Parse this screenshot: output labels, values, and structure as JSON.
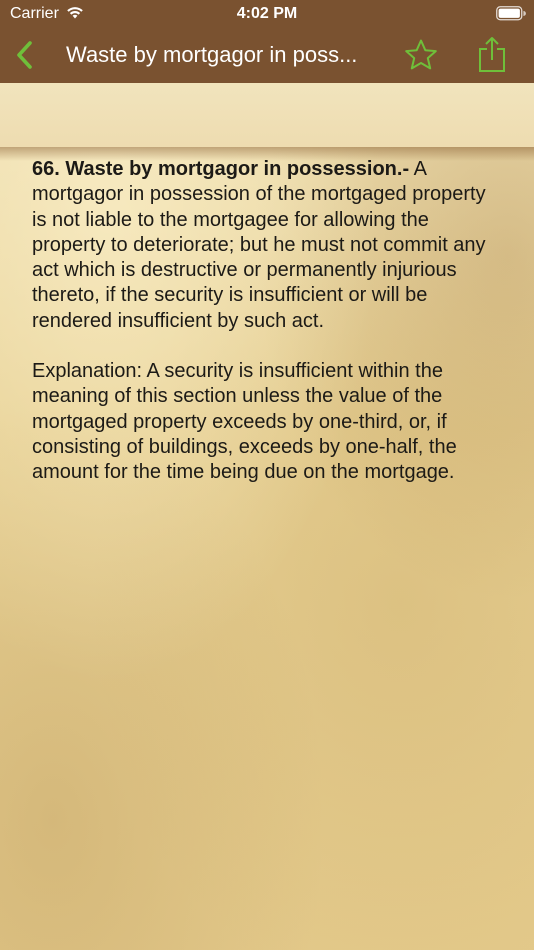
{
  "status_bar": {
    "carrier": "Carrier",
    "time": "4:02 PM"
  },
  "nav_bar": {
    "title": "Waste by mortgagor in poss...",
    "accent_color": "#6fbf3a",
    "icons": [
      "chevron-left-icon",
      "star-outline-icon",
      "share-icon"
    ]
  },
  "section": {
    "heading": "66. Waste by mortgagor in possession.-",
    "body": " A mortgagor in possession of the mortgaged property is not liable to the mortgagee for allowing the property to deteriorate; but he must not commit any act which is destructive or permanently injurious thereto, if the security is insufficient or will be rendered insufficient by such act.",
    "explanation": "Explanation: A security is insufficient within the meaning of this section unless the value of the mortgaged property exceeds by one-third, or, if consisting of buildings, exceeds by one-half, the amount for the time being due on the mortgage."
  }
}
